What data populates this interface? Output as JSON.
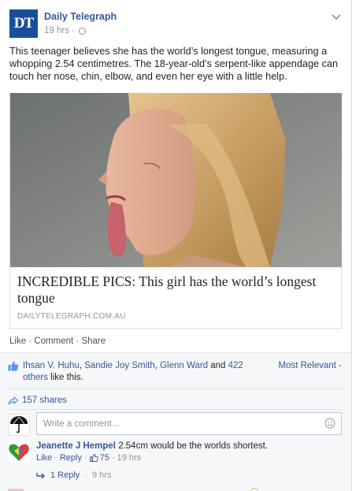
{
  "post": {
    "page_logo_text": "DT",
    "page_name": "Daily Telegraph",
    "timestamp": "19 hrs",
    "separator": "·",
    "privacy_icon": "globe-icon",
    "options_icon": "chevron-down-icon",
    "text": "This teenager believes she has the world’s longest tongue, measuring a whopping 2.54 centimetres. The 18-year-old’s serpent-like appendage can touch her nose, chin, elbow, and even her eye with a little help."
  },
  "link_card": {
    "title": "INCREDIBLE PICS: This girl has the world’s longest tongue",
    "domain": "DAILYTELEGRAPH.COM.AU"
  },
  "actions": {
    "like": "Like",
    "comment": "Comment",
    "share": "Share",
    "dot": " · "
  },
  "feedback": {
    "likers": [
      "Ihsan V. Huhu",
      "Sandie Joy Smith",
      "Glenn Ward"
    ],
    "sep1": ", ",
    "sep2": ", ",
    "and_text": " and ",
    "others": "422 others",
    "like_this": " like this.",
    "most_relevant": "Most Relevant -",
    "shares": "157 shares",
    "comment_placeholder": "Write a comment..."
  },
  "comments": [
    {
      "author": "Jeanette J Hempel",
      "text": " 2.54cm would be the worlds shortest.",
      "like": "Like",
      "reply": "Reply",
      "likes_count": "75",
      "time": "19 hrs",
      "replies_label": "1 Reply",
      "replies_time": "9 hrs"
    }
  ],
  "colors": {
    "link": "#365899",
    "meta": "#90949c",
    "logo_bg": "#1a4e9c",
    "feedback_bg": "#f6f7f9"
  }
}
